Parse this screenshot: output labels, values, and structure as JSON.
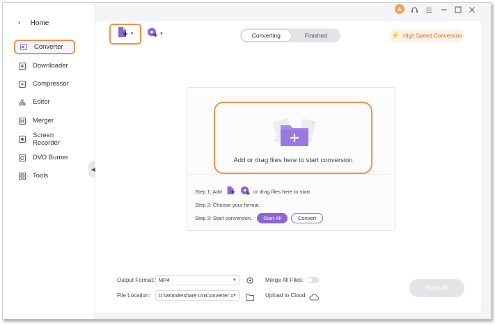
{
  "sidebar": {
    "home_label": "Home",
    "items": [
      {
        "label": "Converter",
        "icon": "converter-icon",
        "active": true
      },
      {
        "label": "Downloader",
        "icon": "downloader-icon",
        "active": false
      },
      {
        "label": "Compressor",
        "icon": "compressor-icon",
        "active": false
      },
      {
        "label": "Editor",
        "icon": "scissors-icon",
        "active": false
      },
      {
        "label": "Merger",
        "icon": "merger-icon",
        "active": false
      },
      {
        "label": "Screen Recorder",
        "icon": "screen-recorder-icon",
        "active": false
      },
      {
        "label": "DVD Burner",
        "icon": "dvd-icon",
        "active": false
      },
      {
        "label": "Tools",
        "icon": "tools-grid-icon",
        "active": false
      }
    ]
  },
  "titlebar": {
    "avatar_letter": "A"
  },
  "toolbar": {
    "tabs": [
      {
        "label": "Converting",
        "active": true
      },
      {
        "label": "Finished",
        "active": false
      }
    ],
    "high_speed_label": "High Speed Conversion"
  },
  "dropzone": {
    "text": "Add or drag files here to start conversion",
    "step1_prefix": "Step 1: Add",
    "step1_suffix": "or drag files here to start.",
    "step2": "Step 2: Choose your format.",
    "step3": "Step 3: Start conversion.",
    "start_all_label": "Start All",
    "convert_label": "Convert"
  },
  "bottom": {
    "output_format_label": "Output Format:",
    "output_format_value": "MP4",
    "file_location_label": "File Location:",
    "file_location_value": "D:\\Wondershare UniConverter 1",
    "merge_label": "Merge All Files:",
    "upload_label": "Upload to Cloud",
    "start_all_label": "Start All"
  },
  "colors": {
    "accent_orange": "#f0924a",
    "accent_purple": "#8e63d8"
  }
}
